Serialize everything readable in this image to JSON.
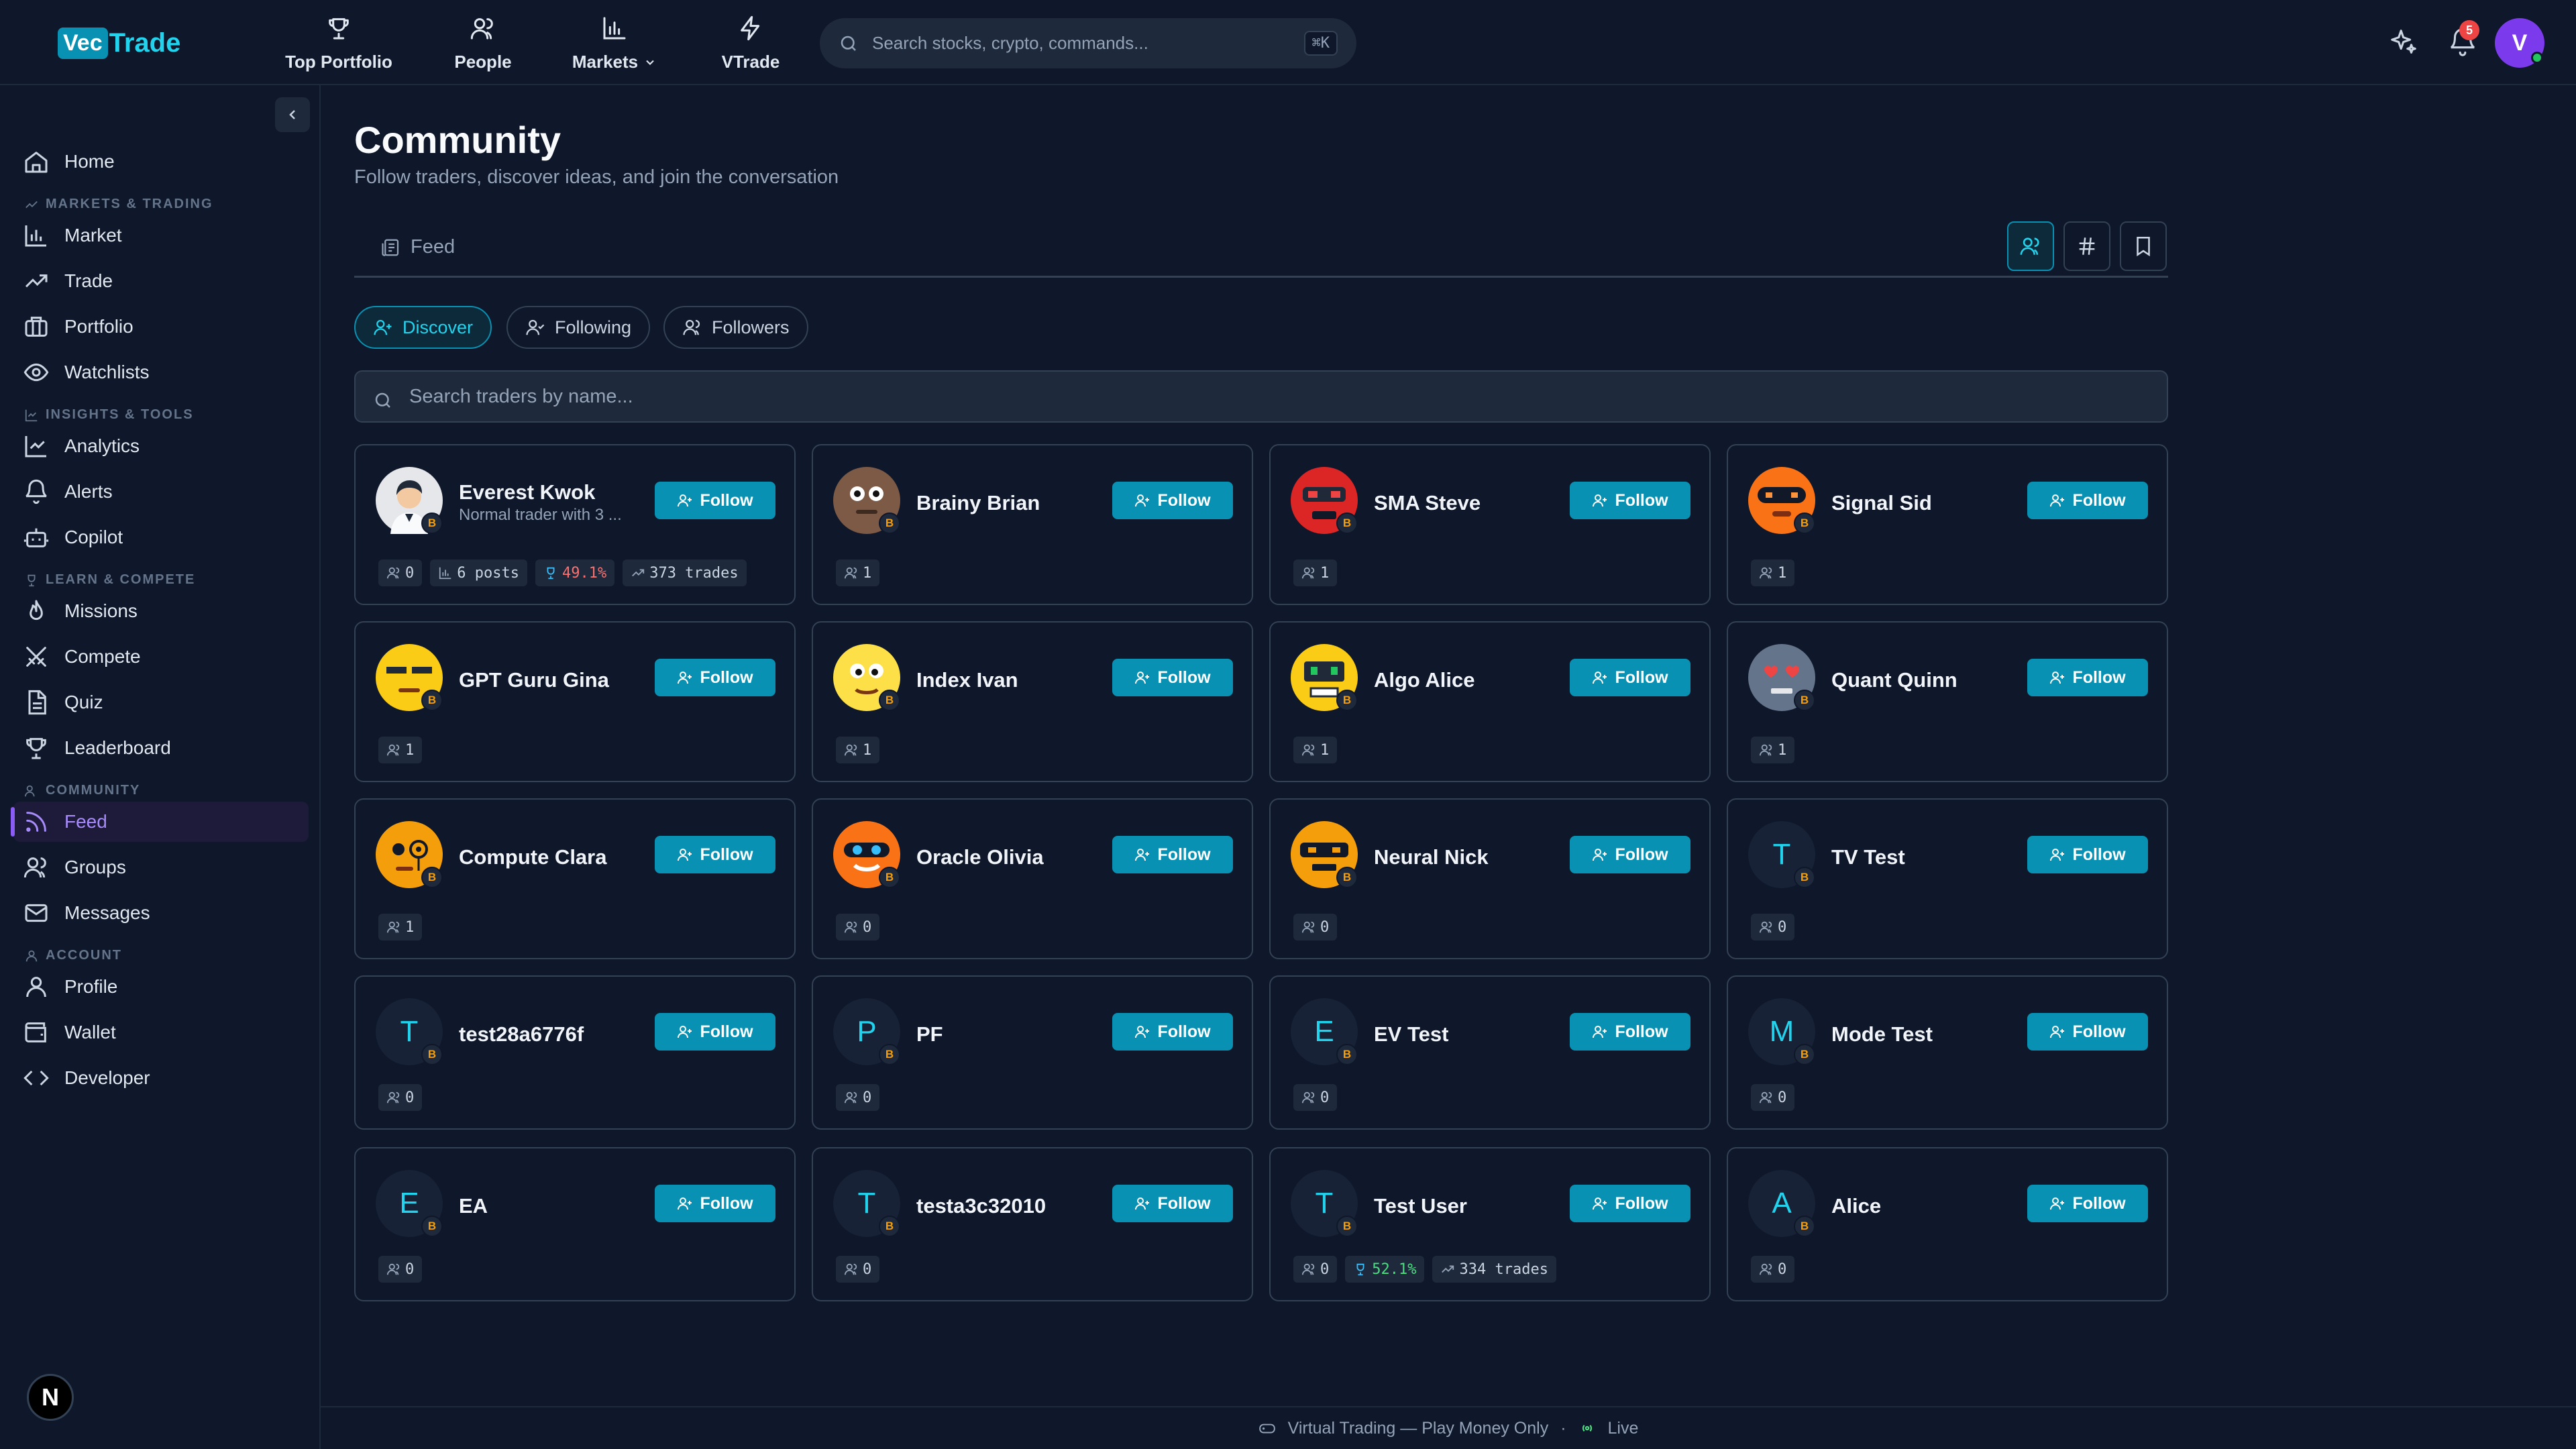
{
  "app": {
    "logo_vec": "Vec",
    "logo_trade": "Trade"
  },
  "topnav": [
    {
      "label": "Top Portfolio",
      "icon": "trophy-icon"
    },
    {
      "label": "People",
      "icon": "people-icon"
    },
    {
      "label": "Markets",
      "icon": "bar-chart-icon"
    },
    {
      "label": "VTrade",
      "icon": "bolt-icon"
    }
  ],
  "search": {
    "placeholder": "Search stocks, crypto, commands...",
    "shortcut": "⌘K"
  },
  "notifications": {
    "count": "5"
  },
  "user": {
    "initial": "V"
  },
  "sidebar": {
    "home": "Home",
    "sections": {
      "markets": "MARKETS & TRADING",
      "insights": "INSIGHTS & TOOLS",
      "learn": "LEARN & COMPETE",
      "community": "COMMUNITY",
      "account": "ACCOUNT"
    },
    "items": {
      "market": "Market",
      "trade": "Trade",
      "portfolio": "Portfolio",
      "watchlists": "Watchlists",
      "analytics": "Analytics",
      "alerts": "Alerts",
      "copilot": "Copilot",
      "missions": "Missions",
      "compete": "Compete",
      "quiz": "Quiz",
      "leaderboard": "Leaderboard",
      "feed": "Feed",
      "groups": "Groups",
      "messages": "Messages",
      "profile": "Profile",
      "wallet": "Wallet",
      "developer": "Developer"
    },
    "n_badge": "N"
  },
  "page": {
    "title": "Community",
    "subtitle": "Follow traders, discover ideas, and join the conversation",
    "tab_feed": "Feed",
    "pills": {
      "discover": "Discover",
      "following": "Following",
      "followers": "Followers"
    },
    "search_placeholder": "Search traders by name...",
    "follow_label": "Follow"
  },
  "traders": [
    {
      "name": "Everest Kwok",
      "bio": "Normal trader with 3 ...",
      "followers": "0",
      "posts": "6 posts",
      "winrate": "49.1%",
      "trades": "373 trades",
      "avatar": "photo"
    },
    {
      "name": "Brainy Brian",
      "followers": "1",
      "avatar": "brown-bot"
    },
    {
      "name": "SMA Steve",
      "followers": "1",
      "avatar": "red-bot"
    },
    {
      "name": "Signal Sid",
      "followers": "1",
      "avatar": "orange-red-bot"
    },
    {
      "name": "GPT Guru Gina",
      "followers": "1",
      "avatar": "yellow-shades"
    },
    {
      "name": "Index Ivan",
      "followers": "1",
      "avatar": "yellow-eyes"
    },
    {
      "name": "Algo Alice",
      "followers": "1",
      "avatar": "yellow-screen"
    },
    {
      "name": "Quant Quinn",
      "followers": "1",
      "avatar": "gray-hearts"
    },
    {
      "name": "Compute Clara",
      "followers": "1",
      "avatar": "orange-monocle"
    },
    {
      "name": "Oracle Olivia",
      "followers": "0",
      "avatar": "orange-goggles"
    },
    {
      "name": "Neural Nick",
      "followers": "0",
      "avatar": "orange-visor"
    },
    {
      "name": "TV Test",
      "followers": "0",
      "letter": "T"
    },
    {
      "name": "test28a6776f",
      "followers": "0",
      "letter": "T"
    },
    {
      "name": "PF",
      "followers": "0",
      "letter": "P"
    },
    {
      "name": "EV Test",
      "followers": "0",
      "letter": "E"
    },
    {
      "name": "Mode Test",
      "followers": "0",
      "letter": "M"
    },
    {
      "name": "EA",
      "followers": "0",
      "letter": "E"
    },
    {
      "name": "testa3c32010",
      "followers": "0",
      "letter": "T"
    },
    {
      "name": "Test User",
      "followers": "0",
      "winrate": "52.1%",
      "trades": "334 trades",
      "letter": "T"
    },
    {
      "name": "Alice",
      "followers": "0",
      "letter": "A"
    }
  ],
  "badge_letter": "B",
  "footer": {
    "text": "Virtual Trading — Play Money Only",
    "sep": "·",
    "live": "Live"
  }
}
